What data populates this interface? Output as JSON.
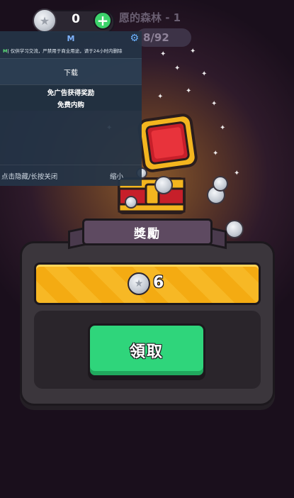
{
  "top_bar": {
    "coin_count": "0",
    "level_title": "愿的森林 - 1",
    "progress": "8/92"
  },
  "overlay_panel": {
    "title": "M",
    "notice_prefix": "M",
    "notice_text": "| 仅供学习交流，严禁用于商业用途，请于24小时内删除",
    "download_label": "下载",
    "features": [
      "免广告获得奖励",
      "免费内购"
    ],
    "footer_hint": "点击隐藏/长按关闭",
    "footer_minimize": "缩小"
  },
  "reward_dialog": {
    "title": "獎勵",
    "reward_amount": "6",
    "claim_label": "領取"
  },
  "colors": {
    "accent_green": "#2fd57b",
    "reward_gold": "#f7b825",
    "panel_bg": "#243446"
  }
}
